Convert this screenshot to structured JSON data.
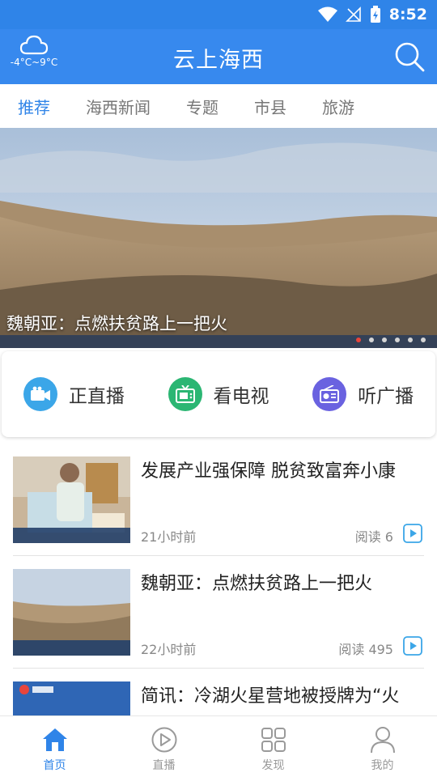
{
  "status_bar": {
    "time": "8:52"
  },
  "header": {
    "weather_temp": "-4°C~9°C",
    "title": "云上海西"
  },
  "tabs": [
    {
      "label": "推荐",
      "active": true
    },
    {
      "label": "海西新闻"
    },
    {
      "label": "专题"
    },
    {
      "label": "市县"
    },
    {
      "label": "旅游"
    }
  ],
  "banner": {
    "caption": "魏朝亚：点燃扶贫路上一把火",
    "slide_count": 6,
    "active_slide": 1
  },
  "quick_entries": [
    {
      "label": "正直播",
      "icon": "camera-icon",
      "color": "#3ba6e8"
    },
    {
      "label": "看电视",
      "icon": "tv-icon",
      "color": "#2bb673"
    },
    {
      "label": "听广播",
      "icon": "radio-icon",
      "color": "#6a62e0"
    }
  ],
  "news": [
    {
      "title": "发展产业强保障 脱贫致富奔小康",
      "time": "21小时前",
      "reads": "阅读 6"
    },
    {
      "title": "魏朝亚：点燃扶贫路上一把火",
      "time": "22小时前",
      "reads": "阅读 495"
    },
    {
      "title": "简讯：冷湖火星营地被授牌为“火",
      "time": "",
      "reads": ""
    }
  ],
  "bottom_nav": [
    {
      "label": "首页",
      "icon": "home-icon",
      "active": true
    },
    {
      "label": "直播",
      "icon": "play-circle-icon"
    },
    {
      "label": "发现",
      "icon": "grid-icon"
    },
    {
      "label": "我的",
      "icon": "user-icon"
    }
  ],
  "colors": {
    "primary": "#2f84e8",
    "header": "#3789ee",
    "active_dot": "#e8453c"
  }
}
